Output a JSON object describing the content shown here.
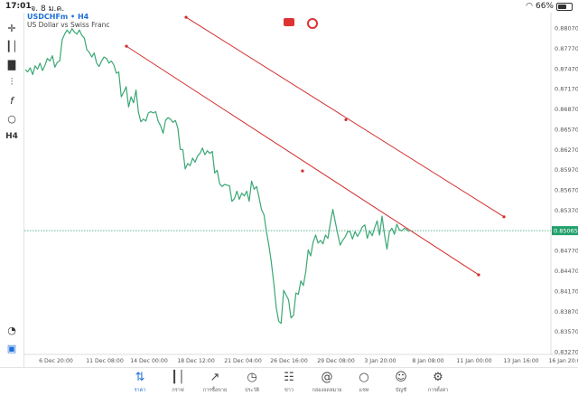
{
  "status_bar": {
    "time": "17:01",
    "date": "จ. 8 ม.ค.",
    "battery": "66%",
    "battery_level": 0.66
  },
  "header": {
    "symbol": "USDCHFm • H4",
    "description": "US Dollar vs Swiss Franc"
  },
  "toolbar": {
    "timeframe": "H4",
    "icons": [
      "crosshair-icon",
      "indicators-icon",
      "chart-type-icon",
      "price-alert-icon",
      "function-icon",
      "objects-icon",
      "timeframe-icon",
      "zoom-icon",
      "app-logo-icon"
    ]
  },
  "colors": {
    "price_line": "#3aa774",
    "trendline": "#d22c2c",
    "current_price": "#22a06b",
    "accent": "#1e6fd9"
  },
  "chart_data": {
    "type": "line",
    "title": "",
    "x_ticks": [
      "6 Dec 20:00",
      "11 Dec 08:00",
      "14 Dec 00:00",
      "18 Dec 12:00",
      "21 Dec 04:00",
      "26 Dec 16:00",
      "29 Dec 08:00",
      "3 Jan 20:00",
      "8 Jan 08:00",
      "11 Jan 00:00",
      "13 Jan 16:00",
      "16 Jan 20:00"
    ],
    "y_ticks": [
      "0.88070",
      "0.87770",
      "0.87470",
      "0.87170",
      "0.86870",
      "0.86570",
      "0.86270",
      "0.85970",
      "0.85670",
      "0.85370",
      "0.85065",
      "0.84770",
      "0.84470",
      "0.84170",
      "0.83870",
      "0.83570",
      "0.83270"
    ],
    "ylim": [
      0.8327,
      0.8807
    ],
    "current_price": 0.85065,
    "series": [
      {
        "values": [
          0.8745,
          0.8742,
          0.8748,
          0.8738,
          0.8751,
          0.8746,
          0.8755,
          0.8744,
          0.8752,
          0.8762,
          0.8758,
          0.8766,
          0.8749,
          0.8756,
          0.8758,
          0.879,
          0.8798,
          0.8804,
          0.8799,
          0.8806,
          0.8801,
          0.8798,
          0.8804,
          0.8796,
          0.8792,
          0.8775,
          0.8771,
          0.8764,
          0.877,
          0.8755,
          0.875,
          0.8758,
          0.8764,
          0.8762,
          0.8755,
          0.8758,
          0.8752,
          0.874,
          0.8742,
          0.8705,
          0.8712,
          0.872,
          0.869,
          0.8705,
          0.8696,
          0.8715,
          0.8682,
          0.8668,
          0.8672,
          0.8669,
          0.8681,
          0.8683,
          0.8681,
          0.8683,
          0.8669,
          0.8662,
          0.8651,
          0.867,
          0.8674,
          0.8672,
          0.8667,
          0.867,
          0.8659,
          0.8627,
          0.8627,
          0.8598,
          0.8606,
          0.8603,
          0.8614,
          0.8608,
          0.8617,
          0.8621,
          0.8629,
          0.8619,
          0.8625,
          0.8621,
          0.8624,
          0.8592,
          0.8596,
          0.8576,
          0.8572,
          0.8575,
          0.8574,
          0.8573,
          0.855,
          0.8554,
          0.8565,
          0.8553,
          0.8562,
          0.8558,
          0.8565,
          0.855,
          0.858,
          0.8568,
          0.8572,
          0.8556,
          0.8538,
          0.853,
          0.8505,
          0.8485,
          0.846,
          0.8428,
          0.8392,
          0.8372,
          0.8369,
          0.8418,
          0.8411,
          0.8404,
          0.8377,
          0.8381,
          0.8414,
          0.8412,
          0.8432,
          0.8425,
          0.8446,
          0.8478,
          0.8469,
          0.849,
          0.85,
          0.8488,
          0.8492,
          0.8487,
          0.85,
          0.8495,
          0.8518,
          0.8538,
          0.8519,
          0.8501,
          0.8485,
          0.8492,
          0.8497,
          0.8505,
          0.8505,
          0.8494,
          0.8505,
          0.8498,
          0.8504,
          0.8512,
          0.8515,
          0.8495,
          0.8506,
          0.8499,
          0.8511,
          0.8521,
          0.85,
          0.8528,
          0.85,
          0.8479,
          0.8505,
          0.851,
          0.8501,
          0.8516,
          0.8508,
          0.8506,
          0.851,
          0.8508,
          0.8505
        ]
      }
    ],
    "trendlines": [
      {
        "start": [
          0.2188,
          0.878
        ],
        "mid": [
          0.5234,
          0.8595
        ],
        "end": [
          0.8281,
          0.8441
        ]
      },
      {
        "start": [
          0.3219,
          0.8823
        ],
        "mid": [
          0.5984,
          0.8671
        ],
        "end": [
          0.8719,
          0.8527
        ]
      }
    ]
  },
  "tabs": [
    {
      "label": "ราคา",
      "icon": "quotes-icon",
      "active": true
    },
    {
      "label": "กราฟ",
      "icon": "chart-icon",
      "active": false
    },
    {
      "label": "การซื้อขาย",
      "icon": "trade-icon",
      "active": false
    },
    {
      "label": "ประวัติ",
      "icon": "history-icon",
      "active": false
    },
    {
      "label": "ข่าว",
      "icon": "news-icon",
      "active": false
    },
    {
      "label": "กล่องจดหมาย",
      "icon": "mailbox-icon",
      "active": false
    },
    {
      "label": "แชท",
      "icon": "chat-icon",
      "active": false
    },
    {
      "label": "บัญชี",
      "icon": "account-icon",
      "active": false
    },
    {
      "label": "การตั้งค่า",
      "icon": "settings-icon",
      "active": false
    }
  ]
}
